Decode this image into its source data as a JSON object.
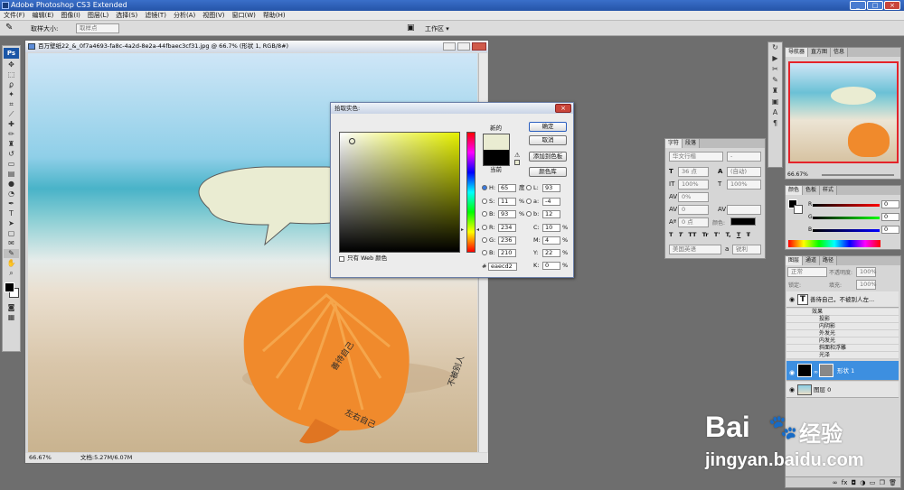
{
  "app": {
    "title": "Adobe Photoshop CS3 Extended",
    "win_buttons": [
      "_",
      "□",
      "×"
    ]
  },
  "menu": [
    "文件(F)",
    "编辑(E)",
    "图像(I)",
    "图层(L)",
    "选择(S)",
    "滤镜(T)",
    "分析(A)",
    "视图(V)",
    "窗口(W)",
    "帮助(H)"
  ],
  "options": {
    "sample_size_label": "取样大小:",
    "sample_size_value": "取样点",
    "workspace_label": "工作区 ▾"
  },
  "document": {
    "title": "百万壁纸22_&_0f7a4693-fa8c-4a2d-8e2a-44fbaec3cf31.jpg @ 66.7% (形状 1, RGB/8#)",
    "zoom": "66.67%",
    "info": "文档:5.27M/6.07M"
  },
  "picker": {
    "title": "拾取实色:",
    "new_label": "新的",
    "current_label": "当前",
    "buttons": {
      "ok": "确定",
      "cancel": "取消",
      "add_swatch": "添加到色板",
      "libraries": "颜色库"
    },
    "hsb": [
      {
        "k": "H:",
        "v": "65",
        "u": "度"
      },
      {
        "k": "S:",
        "v": "11",
        "u": "%"
      },
      {
        "k": "B:",
        "v": "93",
        "u": "%"
      }
    ],
    "rgb": [
      {
        "k": "R:",
        "v": "234"
      },
      {
        "k": "G:",
        "v": "236"
      },
      {
        "k": "B:",
        "v": "210"
      }
    ],
    "lab": [
      {
        "k": "L:",
        "v": "93"
      },
      {
        "k": "a:",
        "v": "-4"
      },
      {
        "k": "b:",
        "v": "12"
      }
    ],
    "cmyk": [
      {
        "k": "C:",
        "v": "10",
        "u": "%"
      },
      {
        "k": "M:",
        "v": "4",
        "u": "%"
      },
      {
        "k": "Y:",
        "v": "22",
        "u": "%"
      },
      {
        "k": "K:",
        "v": "0",
        "u": "%"
      }
    ],
    "hex_label": "#",
    "hex": "eaecd2",
    "web_only": "只有 Web 颜色",
    "new_color": "#eaecd2",
    "current_color": "#000000"
  },
  "char_panel": {
    "tabs": [
      "字符",
      "段落"
    ],
    "font": "华文行楷",
    "style": "-",
    "size": "36 点",
    "leading": "(自动)",
    "vscale": "100%",
    "hscale": "100%",
    "tracking_pct": "0%",
    "kerning": "0",
    "baseline": "0 点",
    "color_label": "颜色:",
    "language": "美国英语",
    "aa_label": "a",
    "aa": "锐利",
    "styles": [
      "T",
      "T",
      "TT",
      "Tr",
      "T'",
      "T,",
      "T",
      "Ŧ"
    ]
  },
  "navigator": {
    "tabs": [
      "导航器",
      "直方图",
      "信息"
    ],
    "zoom": "66.67%"
  },
  "color_panel": {
    "tabs": [
      "颜色",
      "色板",
      "样式"
    ],
    "values": [
      "0",
      "0",
      "0"
    ],
    "labels": [
      "R",
      "G",
      "B"
    ]
  },
  "layers_panel": {
    "tabs": [
      "图层",
      "通道",
      "路径"
    ],
    "blend": "正常",
    "opacity_label": "不透明度:",
    "opacity": "100%",
    "lock_label": "锁定:",
    "fill_label": "填充:",
    "fill": "100%",
    "text_layer": "善待自己，不被别人左...",
    "effects_label": "效果",
    "effects": [
      "投影",
      "内阴影",
      "外发光",
      "内发光",
      "斜面和浮雕",
      "光泽"
    ],
    "shape_layer": "形状 1",
    "bg_layer": "图层 0",
    "fx_mark": "fx"
  },
  "watermark": {
    "brand": "Bai",
    "brand2": "经验",
    "url": "jingyan.baidu.com"
  },
  "icons": [
    "eyedropper-icon",
    "move-icon",
    "marquee-icon",
    "lasso-icon",
    "magic-wand-icon",
    "crop-icon",
    "slice-icon",
    "healing-icon",
    "brush-icon",
    "stamp-icon",
    "history-brush-icon",
    "eraser-icon",
    "gradient-icon",
    "blur-icon",
    "dodge-icon",
    "pen-icon",
    "type-icon",
    "path-select-icon",
    "shape-icon",
    "notes-icon",
    "eyedropper-icon",
    "hand-icon",
    "zoom-icon"
  ]
}
